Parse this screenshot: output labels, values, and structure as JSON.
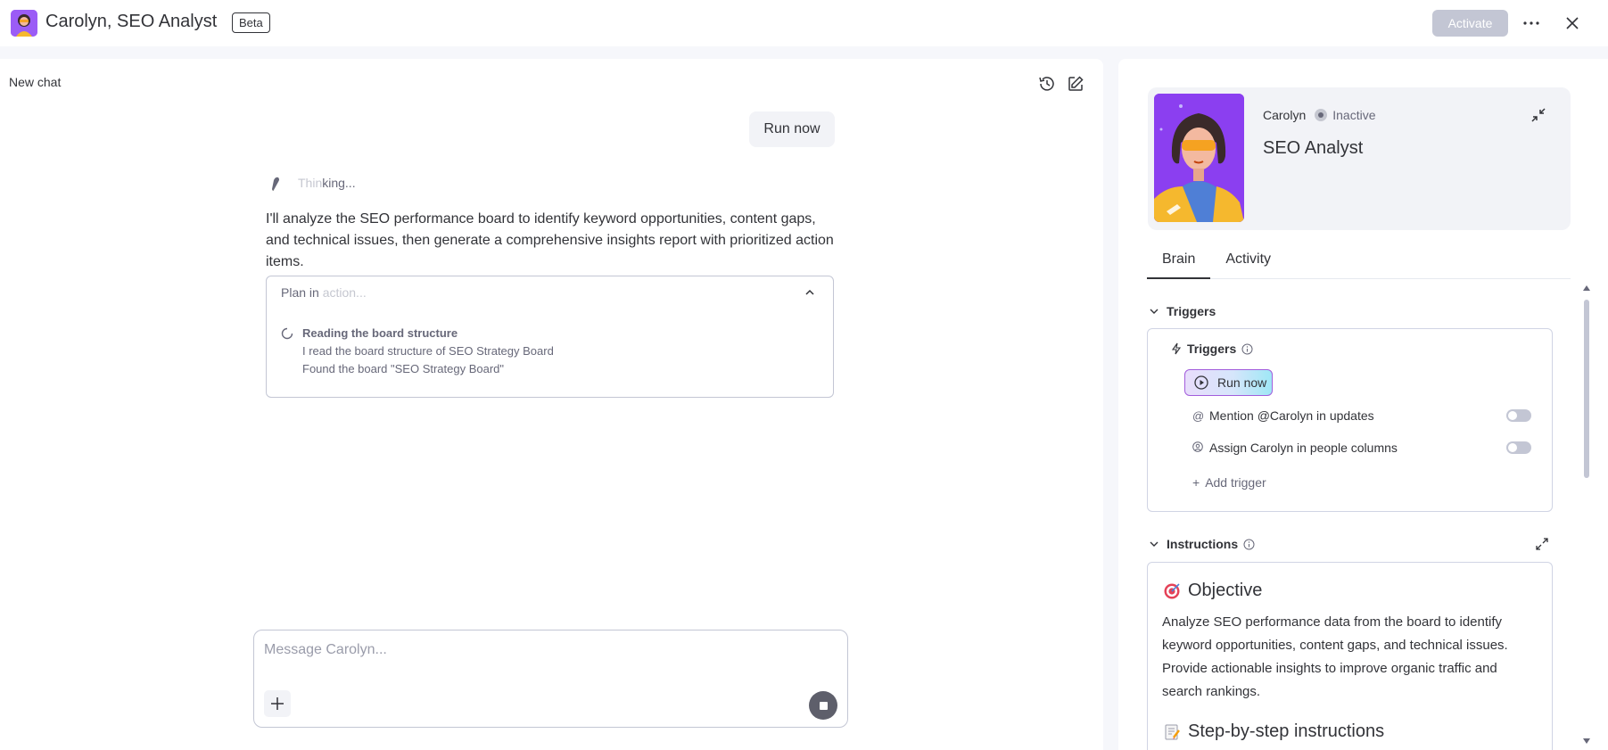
{
  "header": {
    "title": "Carolyn, SEO Analyst",
    "badge": "Beta",
    "activate_label": "Activate"
  },
  "chat": {
    "new_chat_label": "New chat",
    "user_message": "Run now",
    "thinking_bright": "Thin",
    "thinking_dim": "king...",
    "assistant_message": "I'll analyze the SEO performance board to identify keyword opportunities, content gaps, and technical issues, then generate a comprehensive insights report with prioritized action items.",
    "plan": {
      "header_bright": "Plan in ",
      "header_dim": "action...",
      "step_title": "Reading the board structure",
      "step_details": [
        "I read the board structure of SEO Strategy Board",
        "Found the board \"SEO Strategy Board\""
      ]
    },
    "composer": {
      "placeholder": "Message Carolyn..."
    }
  },
  "agent": {
    "name": "Carolyn",
    "status": "Inactive",
    "role": "SEO Analyst"
  },
  "tabs": [
    {
      "label": "Brain",
      "active": true
    },
    {
      "label": "Activity",
      "active": false
    }
  ],
  "triggers": {
    "section_label": "Triggers",
    "box_title": "Triggers",
    "run_now_label": "Run now",
    "items": [
      {
        "icon": "at-icon",
        "label": "Mention @Carolyn in updates",
        "enabled": false
      },
      {
        "icon": "person-icon",
        "label": "Assign Carolyn in people columns",
        "enabled": false
      }
    ],
    "add_label": "Add trigger"
  },
  "instructions": {
    "section_label": "Instructions",
    "objective_heading": "Objective",
    "objective_text": "Analyze SEO performance data from the board to identify keyword opportunities, content gaps, and technical issues. Provide actionable insights to improve organic traffic and search rankings.",
    "steps_heading": "Step-by-step instructions"
  },
  "colors": {
    "accent_purple": "#a25ddc",
    "activate_disabled": "#c3c6d4",
    "text_primary": "#323338",
    "text_secondary": "#676879"
  }
}
